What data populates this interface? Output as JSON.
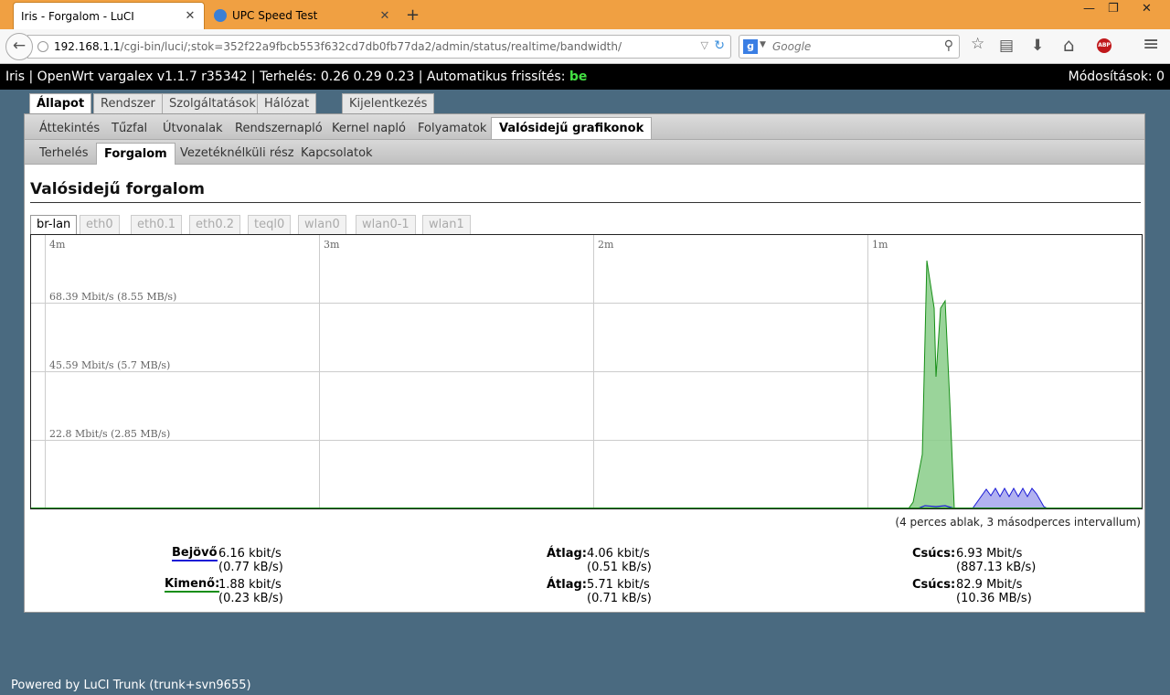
{
  "browser": {
    "tabs": [
      {
        "title": "Iris - Forgalom - LuCI",
        "active": true
      },
      {
        "title": "UPC Speed Test",
        "active": false
      }
    ],
    "new_tab": "+",
    "close_glyph": "✕",
    "window": {
      "minimize": "—",
      "restore": "❐",
      "close": "✕"
    },
    "url": {
      "host": "192.168.1.1",
      "path": "/cgi-bin/luci/;stok=352f22a9fbcb553f632cd7db0fb77da2/admin/status/realtime/bandwidth/"
    },
    "search_placeholder": "Google",
    "search_engine_letter": "g",
    "icons": {
      "back": "←",
      "reload": "↻",
      "dropdown": "▽",
      "search": "⚲",
      "bookmark": "☆",
      "reading": "▤",
      "download": "⬇",
      "home": "⌂",
      "adblock": "ABP",
      "menu": "≡"
    }
  },
  "topbar": {
    "status": "Iris | OpenWrt vargalex v1.1.7 r35342 | Terhelés: 0.26 0.29 0.23 | Automatikus frissítés: ",
    "autorefresh": "be",
    "changes": "Módosítások: 0"
  },
  "main_tabs": [
    "Állapot",
    "Rendszer",
    "Szolgáltatások",
    "Hálózat",
    "Kijelentkezés"
  ],
  "sub_tabs": [
    "Áttekintés",
    "Tűzfal",
    "Útvonalak",
    "Rendszernapló",
    "Kernel napló",
    "Folyamatok",
    "Valósidejű grafikonok"
  ],
  "sub_sub_tabs": [
    "Terhelés",
    "Forgalom",
    "Vezetéknélküli rész",
    "Kapcsolatok"
  ],
  "page_title": "Valósidejű forgalom",
  "interface_tabs": [
    "br-lan",
    "eth0",
    "eth0.1",
    "eth0.2",
    "teql0",
    "wlan0",
    "wlan0-1",
    "wlan1"
  ],
  "graph": {
    "time_labels": [
      "4m",
      "3m",
      "2m",
      "1m"
    ],
    "value_labels": [
      "68.39 Mbit/s (8.55 MB/s)",
      "45.59 Mbit/s (5.7 MB/s)",
      "22.8 Mbit/s (2.85 MB/s)"
    ],
    "colors": {
      "rx_line": "#1a1ad6",
      "rx_fill": "#aaaaee",
      "tx_line": "#168e16",
      "tx_fill": "#88cc88"
    }
  },
  "window_note": "(4 perces ablak, 3 másodperces intervallum)",
  "stats": {
    "in_label": "Bejövő",
    "in_current": "6.16 kbit/s",
    "in_current_bytes": "(0.77 kB/s)",
    "out_label": "Kimenő:",
    "out_current": "1.88 kbit/s",
    "out_current_bytes": "(0.23 kB/s)",
    "avg_label": "Átlag:",
    "in_avg": "4.06 kbit/s",
    "in_avg_bytes": "(0.51 kB/s)",
    "out_avg": "5.71 kbit/s",
    "out_avg_bytes": "(0.71 kB/s)",
    "peak_label": "Csúcs:",
    "in_peak": "6.93 Mbit/s",
    "in_peak_bytes": "(887.13 kB/s)",
    "out_peak": "82.9 Mbit/s",
    "out_peak_bytes": "(10.36 MB/s)"
  },
  "footer": "Powered by LuCI Trunk (trunk+svn9655)"
}
